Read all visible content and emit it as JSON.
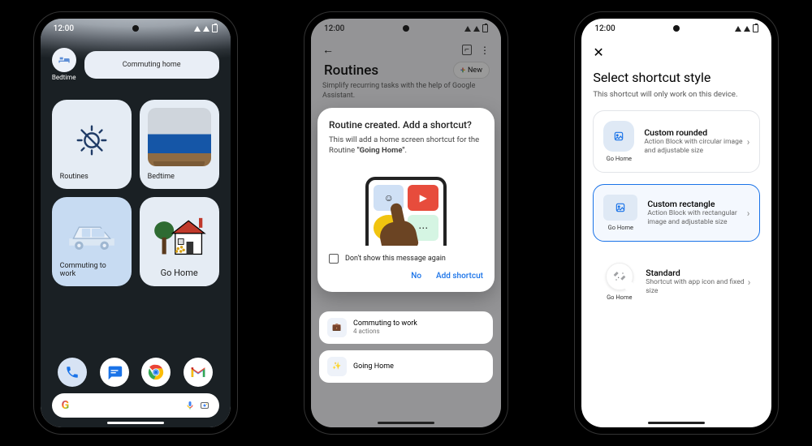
{
  "status_time": "12:00",
  "phone1": {
    "bedtime_label": "Bedtime",
    "commuting_home_label": "Commuting home",
    "tile_routines": "Routines",
    "tile_bedtime": "Bedtime",
    "tile_commuting_work": "Commuting to work",
    "tile_go_home": "Go Home"
  },
  "phone2": {
    "back_page_title": "Routines",
    "back_page_subtitle": "Simplify recurring tasks with the help of Google Assistant.",
    "new_button": "New",
    "dialog_title": "Routine created. Add a shortcut?",
    "dialog_text_1": "This will add a home screen shortcut for the Routine ",
    "dialog_routine_name": "\"Going Home\"",
    "dont_show_label": "Don't show this message again",
    "action_no": "No",
    "action_add": "Add shortcut",
    "bg_rows": [
      {
        "title": "Commuting to work",
        "sub": "4 actions"
      },
      {
        "title": "Going Home",
        "sub": ""
      }
    ]
  },
  "phone3": {
    "title": "Select shortcut style",
    "subtitle": "This shortcut will only work on this device.",
    "options": [
      {
        "preview_label": "Go Home",
        "title": "Custom rounded",
        "desc": "Action Block with circular image and adjustable size"
      },
      {
        "preview_label": "Go Home",
        "title": "Custom rectangle",
        "desc": "Action Block with rectangular image and adjustable size"
      },
      {
        "preview_label": "Go Home",
        "title": "Standard",
        "desc": "Shortcut with app icon and fixed size"
      }
    ]
  }
}
